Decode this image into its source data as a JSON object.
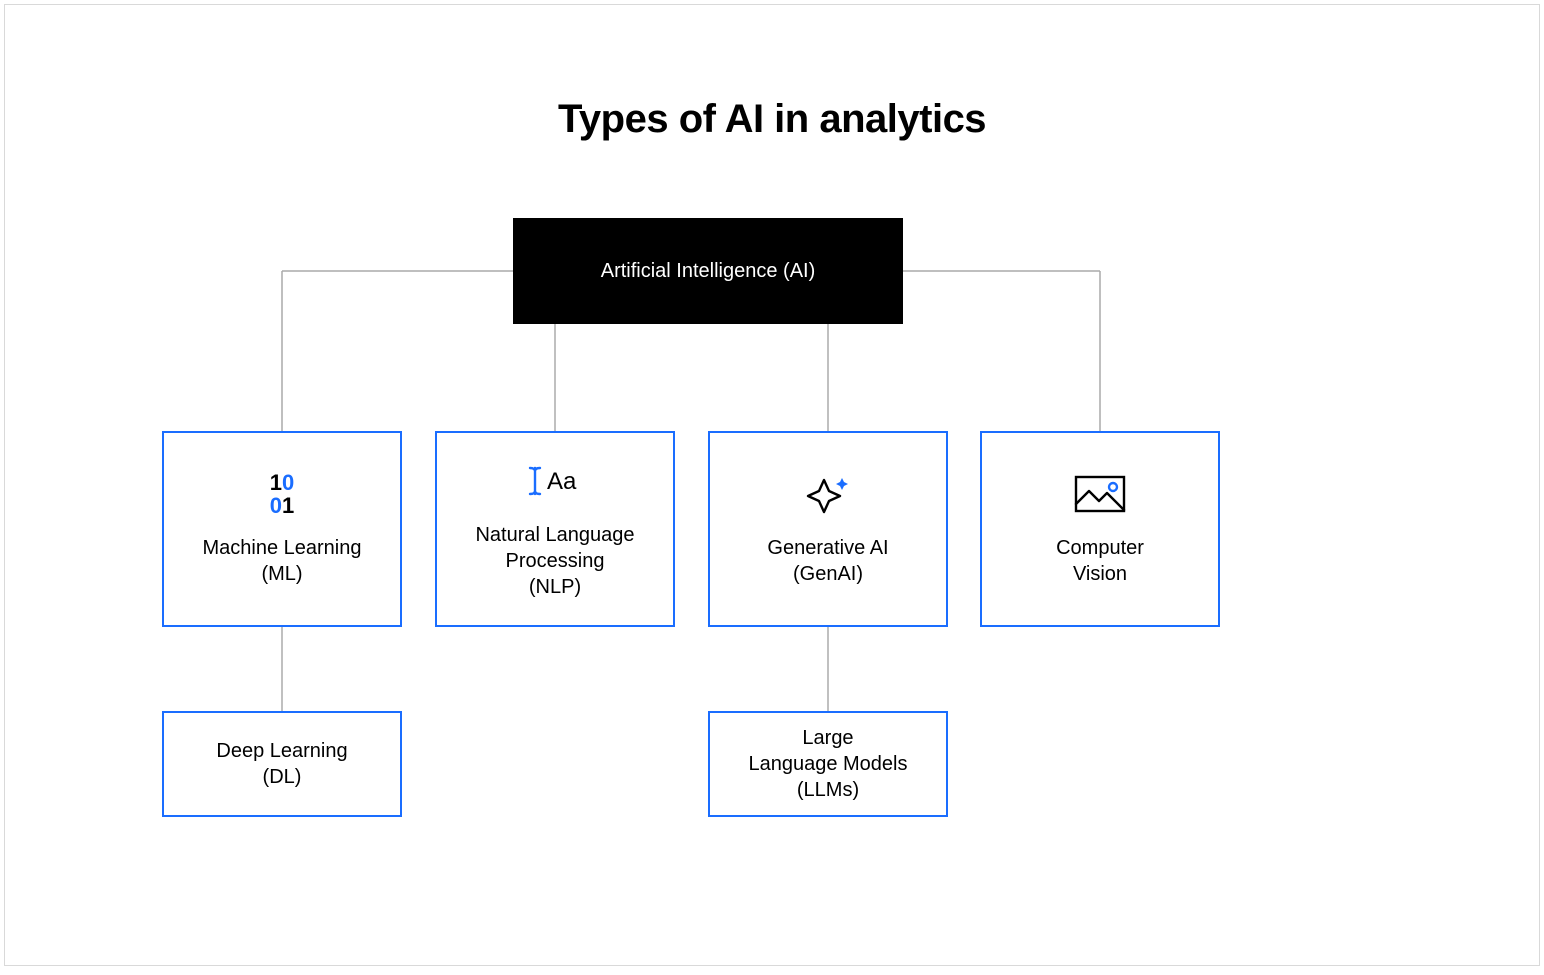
{
  "title": "Types of AI in analytics",
  "root": {
    "label": "Artificial Intelligence (AI)"
  },
  "children": [
    {
      "id": "ml",
      "label": "Machine Learning\n(ML)",
      "icon": "binary-icon"
    },
    {
      "id": "nlp",
      "label": "Natural Language\nProcessing\n(NLP)",
      "icon": "text-cursor-icon"
    },
    {
      "id": "genai",
      "label": "Generative AI\n(GenAI)",
      "icon": "sparkle-icon"
    },
    {
      "id": "cv",
      "label": "Computer\nVision",
      "icon": "image-icon"
    }
  ],
  "grandchildren": [
    {
      "parent": "ml",
      "label": "Deep Learning\n(DL)"
    },
    {
      "parent": "genai",
      "label": "Large\nLanguage Models\n(LLMs)"
    }
  ],
  "colors": {
    "accent": "#1a6dff",
    "root_bg": "#000000",
    "root_fg": "#ffffff",
    "connector": "#aaaaaa"
  }
}
